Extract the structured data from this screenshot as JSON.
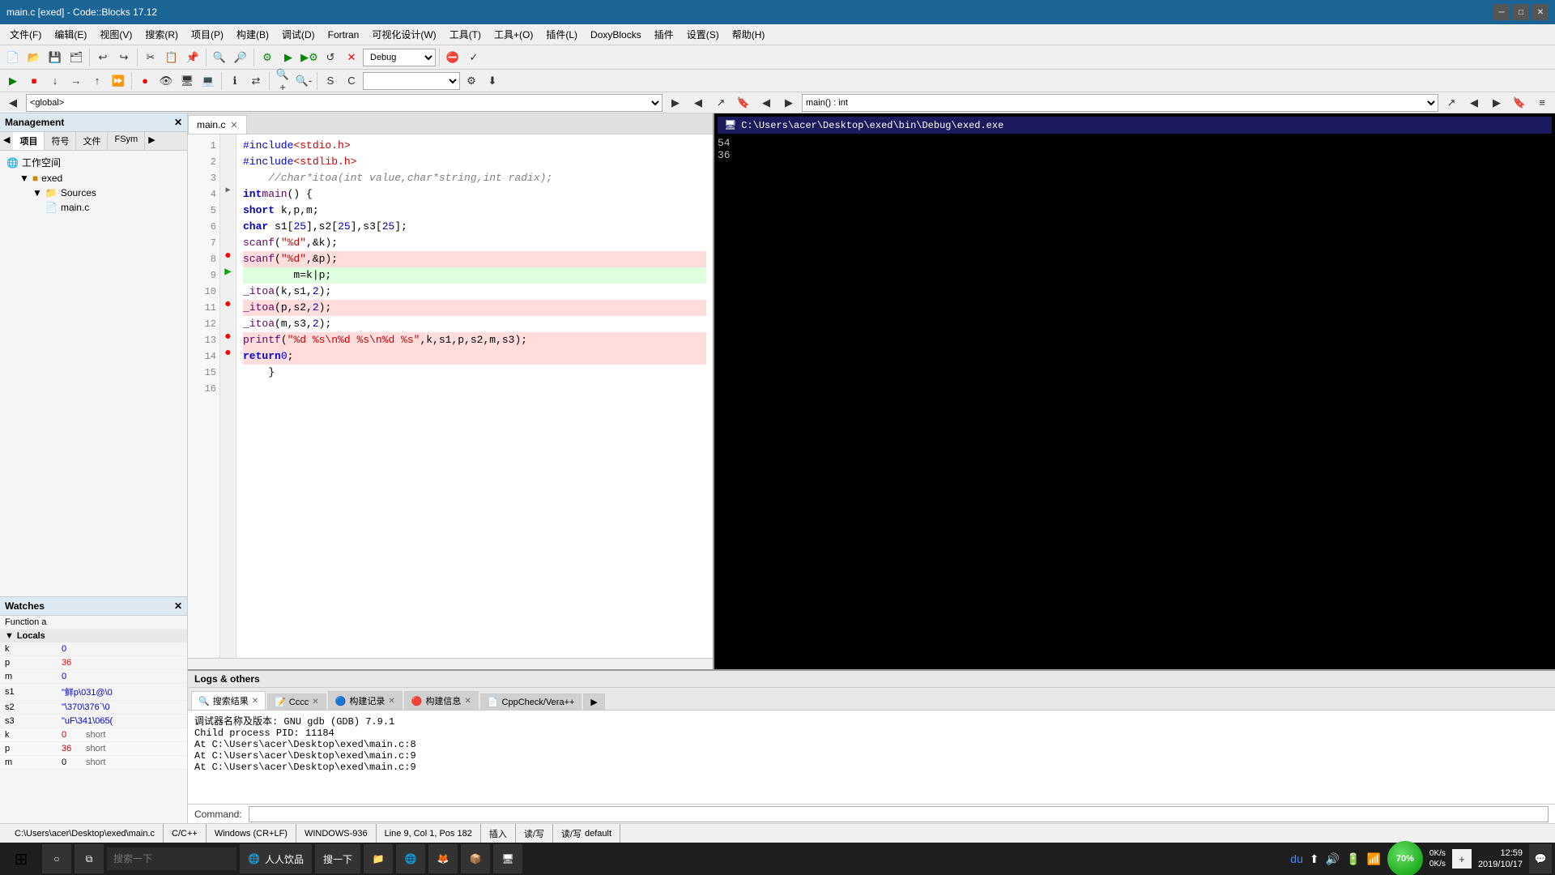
{
  "titlebar": {
    "title": "main.c [exed] - Code::Blocks 17.12"
  },
  "menubar": {
    "items": [
      "文件(F)",
      "编辑(E)",
      "视图(V)",
      "搜索(R)",
      "项目(P)",
      "构建(B)",
      "调试(D)",
      "Fortran",
      "可视化设计(W)",
      "工具(T)",
      "工具+(O)",
      "插件(L)",
      "DoxyBlocks",
      "插件",
      "设置(S)",
      "帮助(H)"
    ]
  },
  "debug_toolbar": {
    "combo_label": "Debug"
  },
  "funcbar": {
    "left_combo": "<global>",
    "right_combo": "main() : int"
  },
  "management": {
    "title": "Management",
    "tabs": [
      "项目",
      "符号",
      "文件",
      "FSym"
    ],
    "tree": {
      "workspace": "工作空间",
      "project": "exed",
      "sources": "Sources",
      "file": "main.c"
    }
  },
  "watches": {
    "title": "Watches",
    "function": "Function a",
    "locals_label": "Locals",
    "rows": [
      {
        "name": "k",
        "value": "0",
        "type": "short"
      },
      {
        "name": "p",
        "value": "36",
        "type": "short"
      },
      {
        "name": "m",
        "value": "0",
        "type": "short"
      },
      {
        "name": "s1",
        "value": "\"鲜p\\031@\\0",
        "type": ""
      },
      {
        "name": "s2",
        "value": "\"\\370\\376`\\0",
        "type": ""
      },
      {
        "name": "s3",
        "value": "\"uF\\341\\065(",
        "type": ""
      }
    ]
  },
  "editor": {
    "filename": "main.c",
    "lines": [
      {
        "num": 1,
        "text": "    #include <stdio.h>",
        "marker": ""
      },
      {
        "num": 2,
        "text": "    #include <stdlib.h>",
        "marker": ""
      },
      {
        "num": 3,
        "text": "    //char*itoa(int value,char*string,int radix);",
        "marker": ""
      },
      {
        "num": 4,
        "text": "int main() {",
        "marker": "fold"
      },
      {
        "num": 5,
        "text": "        short k,p,m;",
        "marker": ""
      },
      {
        "num": 6,
        "text": "        char s1[25],s2[25],s3[25];",
        "marker": ""
      },
      {
        "num": 7,
        "text": "        scanf(\"%d\",&k);",
        "marker": ""
      },
      {
        "num": 8,
        "text": "        scanf(\"%d\",&p);",
        "marker": "bp"
      },
      {
        "num": 9,
        "text": "        m=k|p;",
        "marker": "arrow"
      },
      {
        "num": 10,
        "text": "        _itoa(k,s1,2);",
        "marker": ""
      },
      {
        "num": 11,
        "text": "        _itoa(p,s2,2);",
        "marker": "bp"
      },
      {
        "num": 12,
        "text": "        _itoa(m,s3,2);",
        "marker": ""
      },
      {
        "num": 13,
        "text": "        printf(\"%d %s\\n%d %s\\n%d %s\",k,s1,p,s2,m,s3);",
        "marker": "bp"
      },
      {
        "num": 14,
        "text": "        return 0;",
        "marker": "bp"
      },
      {
        "num": 15,
        "text": "    }",
        "marker": ""
      },
      {
        "num": 16,
        "text": "",
        "marker": ""
      }
    ]
  },
  "exe_window": {
    "title": "C:\\Users\\acer\\Desktop\\exed\\bin\\Debug\\exed.exe",
    "output": [
      "54",
      "36"
    ]
  },
  "logs": {
    "title": "Logs & others",
    "tabs": [
      "搜索结果",
      "Cccc",
      "构建记录",
      "构建信息",
      "CppCheck/Vera++"
    ],
    "content": [
      "调试器名称及版本: GNU gdb (GDB) 7.9.1",
      "Child process PID: 11184",
      "At C:\\Users\\acer\\Desktop\\exed\\main.c:8",
      "At C:\\Users\\acer\\Desktop\\exed\\main.c:9",
      "At C:\\Users\\acer\\Desktop\\exed\\main.c:9"
    ],
    "command_label": "Command:",
    "command_value": ""
  },
  "statusbar": {
    "filepath": "C:\\Users\\acer\\Desktop\\exed\\main.c",
    "lang": "C/C++",
    "line_ending": "Windows (CR+LF)",
    "encoding": "WINDOWS-936",
    "position": "Line 9, Col 1, Pos 182",
    "mode": "插入",
    "readonly": "读/写",
    "indent": "default"
  },
  "taskbar": {
    "start_icon": "⊞",
    "search_placeholder": "搜索一下",
    "apps": [
      "人人饮品"
    ],
    "systray": {
      "time": "12:59",
      "date": "2019/10/17",
      "percent": "70%"
    }
  }
}
